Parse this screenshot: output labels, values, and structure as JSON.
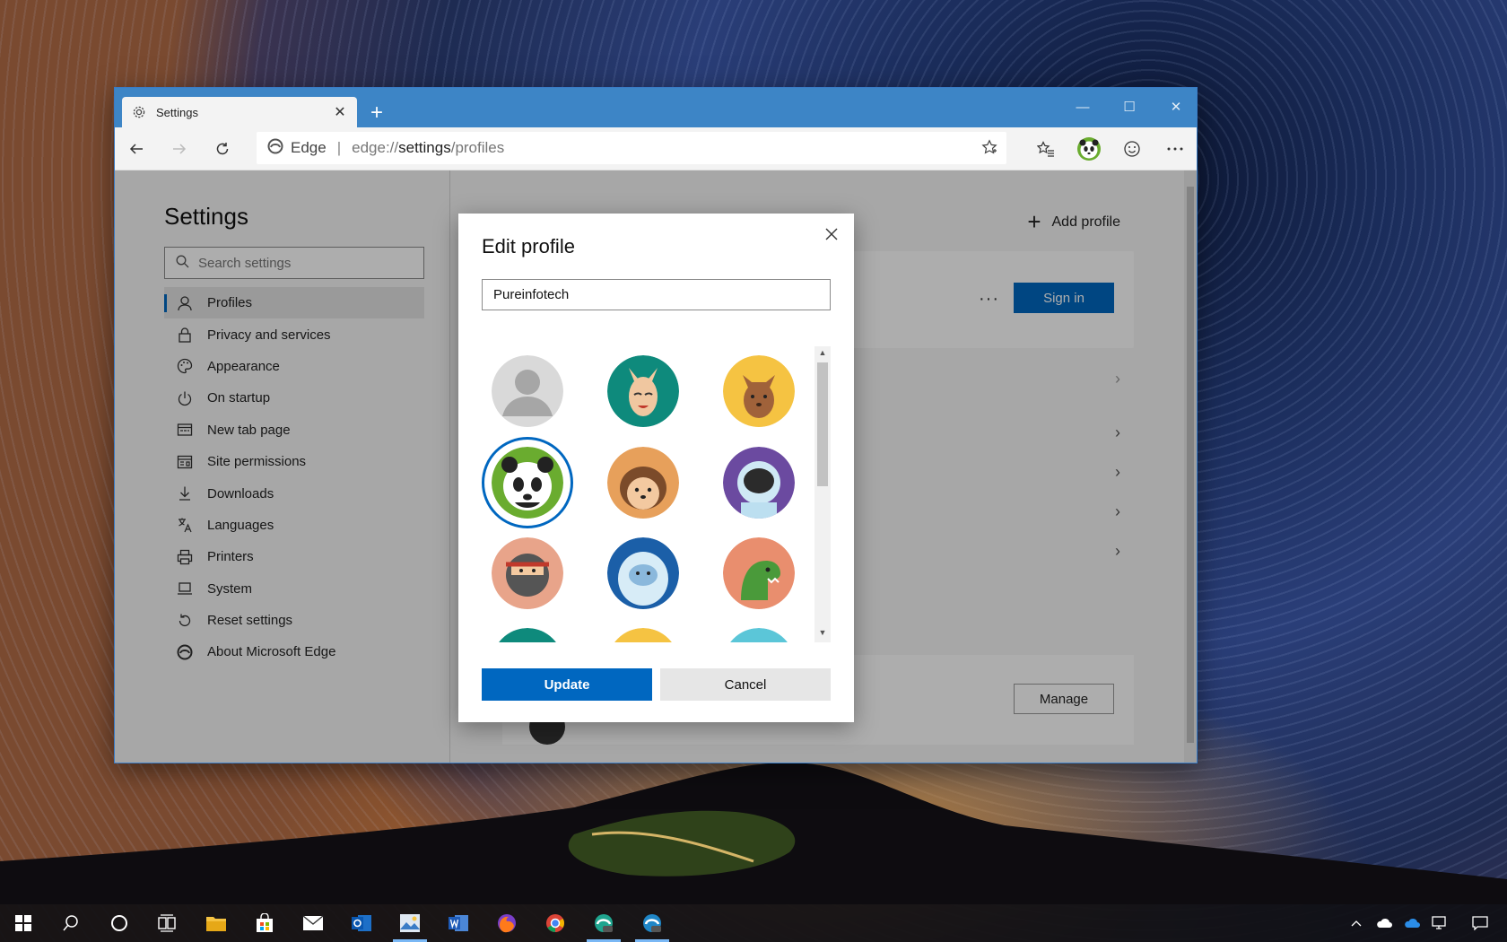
{
  "browser": {
    "tab_title": "Settings",
    "address": {
      "brand": "Edge",
      "scheme": "edge://",
      "host": "settings",
      "path": "/profiles"
    }
  },
  "sidebar": {
    "title": "Settings",
    "search_placeholder": "Search settings",
    "items": [
      {
        "label": "Profiles",
        "icon": "person-icon",
        "active": true
      },
      {
        "label": "Privacy and services",
        "icon": "lock-icon"
      },
      {
        "label": "Appearance",
        "icon": "palette-icon"
      },
      {
        "label": "On startup",
        "icon": "power-icon"
      },
      {
        "label": "New tab page",
        "icon": "newtab-icon"
      },
      {
        "label": "Site permissions",
        "icon": "permissions-icon"
      },
      {
        "label": "Downloads",
        "icon": "download-icon"
      },
      {
        "label": "Languages",
        "icon": "languages-icon"
      },
      {
        "label": "Printers",
        "icon": "printer-icon"
      },
      {
        "label": "System",
        "icon": "laptop-icon"
      },
      {
        "label": "Reset settings",
        "icon": "reset-icon"
      },
      {
        "label": "About Microsoft Edge",
        "icon": "edge-icon"
      }
    ]
  },
  "main": {
    "add_profile_label": "Add profile",
    "more_label": "···",
    "sign_in_label": "Sign in",
    "manage_label": "Manage"
  },
  "dialog": {
    "title": "Edit profile",
    "name_value": "Pureinfotech",
    "update_label": "Update",
    "cancel_label": "Cancel",
    "avatars": [
      {
        "name": "default-avatar",
        "selected": false
      },
      {
        "name": "fox-avatar",
        "selected": false
      },
      {
        "name": "cat-avatar",
        "selected": false
      },
      {
        "name": "panda-avatar",
        "selected": true
      },
      {
        "name": "hedgehog-avatar",
        "selected": false
      },
      {
        "name": "astronaut-avatar",
        "selected": false
      },
      {
        "name": "ninja-avatar",
        "selected": false
      },
      {
        "name": "yeti-avatar",
        "selected": false
      },
      {
        "name": "dinosaur-avatar",
        "selected": false
      }
    ]
  },
  "colors": {
    "accent": "#0067c0",
    "titlebar": "#3d85c6"
  }
}
